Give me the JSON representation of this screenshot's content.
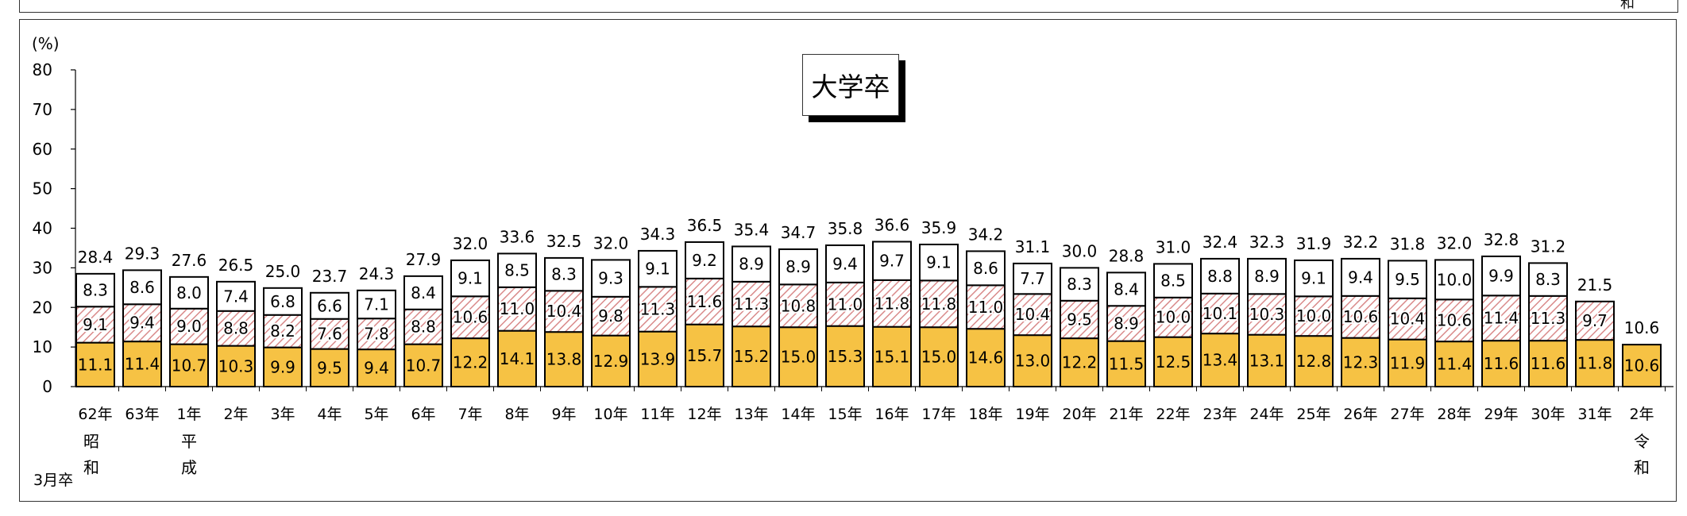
{
  "top_fragment": "和",
  "chart_data": {
    "type": "bar",
    "stacked": true,
    "title": "大学卒",
    "ylabel": "(%)",
    "ylim": [
      0,
      80
    ],
    "yticks": [
      0,
      10,
      20,
      30,
      40,
      50,
      60,
      70,
      80
    ],
    "grid": false,
    "legend": "none",
    "corner_note": "3月卒",
    "categories": [
      "62年",
      "63年",
      "1年",
      "2年",
      "3年",
      "4年",
      "5年",
      "6年",
      "7年",
      "8年",
      "9年",
      "10年",
      "11年",
      "12年",
      "13年",
      "14年",
      "15年",
      "16年",
      "17年",
      "18年",
      "19年",
      "20年",
      "21年",
      "22年",
      "23年",
      "24年",
      "25年",
      "26年",
      "27年",
      "28年",
      "29年",
      "30年",
      "31年",
      "2年"
    ],
    "eras": [
      {
        "index": 0,
        "name": "昭和",
        "chars": [
          "昭",
          "和"
        ]
      },
      {
        "index": 2,
        "name": "平成",
        "chars": [
          "平",
          "成"
        ]
      },
      {
        "index": 33,
        "name": "令和",
        "chars": [
          "令",
          "和"
        ]
      }
    ],
    "series": [
      {
        "values": [
          11.1,
          11.4,
          10.7,
          10.3,
          9.9,
          9.5,
          9.4,
          10.7,
          12.2,
          14.1,
          13.8,
          12.9,
          13.9,
          15.7,
          15.2,
          15.0,
          15.3,
          15.1,
          15.0,
          14.6,
          13.0,
          12.2,
          11.5,
          12.5,
          13.4,
          13.1,
          12.8,
          12.3,
          11.9,
          11.4,
          11.6,
          11.6,
          11.8,
          10.6
        ]
      },
      {
        "values": [
          9.1,
          9.4,
          9.0,
          8.8,
          8.2,
          7.6,
          7.8,
          8.8,
          10.6,
          11.0,
          10.4,
          9.8,
          11.3,
          11.6,
          11.3,
          10.8,
          11.0,
          11.8,
          11.8,
          11.0,
          10.4,
          9.5,
          8.9,
          10.0,
          10.1,
          10.3,
          10.0,
          10.6,
          10.4,
          10.6,
          11.4,
          11.3,
          9.7,
          null
        ]
      },
      {
        "values": [
          8.3,
          8.6,
          8.0,
          7.4,
          6.8,
          6.6,
          7.1,
          8.4,
          9.1,
          8.5,
          8.3,
          9.3,
          9.1,
          9.2,
          8.9,
          8.9,
          9.4,
          9.7,
          9.1,
          8.6,
          7.7,
          8.3,
          8.4,
          8.5,
          8.8,
          8.9,
          9.1,
          9.4,
          9.5,
          10.0,
          9.9,
          8.3,
          null,
          null
        ]
      }
    ],
    "totals": [
      28.4,
      29.3,
      27.6,
      26.5,
      25.0,
      23.7,
      24.3,
      27.9,
      32.0,
      33.6,
      32.5,
      32.0,
      34.3,
      36.5,
      35.4,
      34.7,
      35.8,
      36.6,
      35.9,
      34.2,
      31.1,
      30.0,
      28.8,
      31.0,
      32.4,
      32.3,
      31.9,
      32.2,
      31.8,
      32.0,
      32.8,
      31.2,
      21.5,
      10.6
    ],
    "colors": {
      "series1": "#f6c244",
      "series2_hatch": "#d98a8a",
      "series3": "#ffffff",
      "outline": "#000000"
    }
  }
}
